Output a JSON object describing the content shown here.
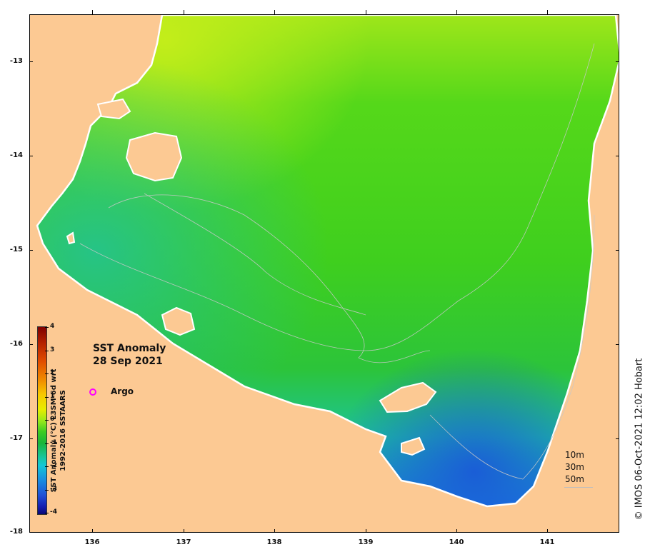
{
  "map": {
    "land_color": "#fcc993",
    "ocean_palette": {
      "warm": "#b8ec1a",
      "mid": "#3fcf1e",
      "cool": "#1fc1a8",
      "cold": "#1566d8"
    },
    "y_ticks": [
      "-13",
      "-14",
      "-15",
      "-16",
      "-17",
      "-18"
    ],
    "x_ticks": [
      "136",
      "137",
      "138",
      "139",
      "140",
      "141"
    ]
  },
  "legend": {
    "title_line1": "SST Anomaly",
    "title_line2": "28 Sep 2021",
    "argo_label": "Argo",
    "argo_color": "#ff00ff"
  },
  "colorbar": {
    "label": "SST Anomaly (°C) L3SM-6d wrt 1992-2016 SSTAARS",
    "ticks": [
      "4",
      "3",
      "2",
      "1",
      "0",
      "-1",
      "-2",
      "-3",
      "-4"
    ],
    "range": [
      -4,
      4
    ]
  },
  "depth_contours": [
    "10m",
    "30m",
    "50m"
  ],
  "credit": "© IMOS 06-Oct-2021 12:02 Hobart"
}
